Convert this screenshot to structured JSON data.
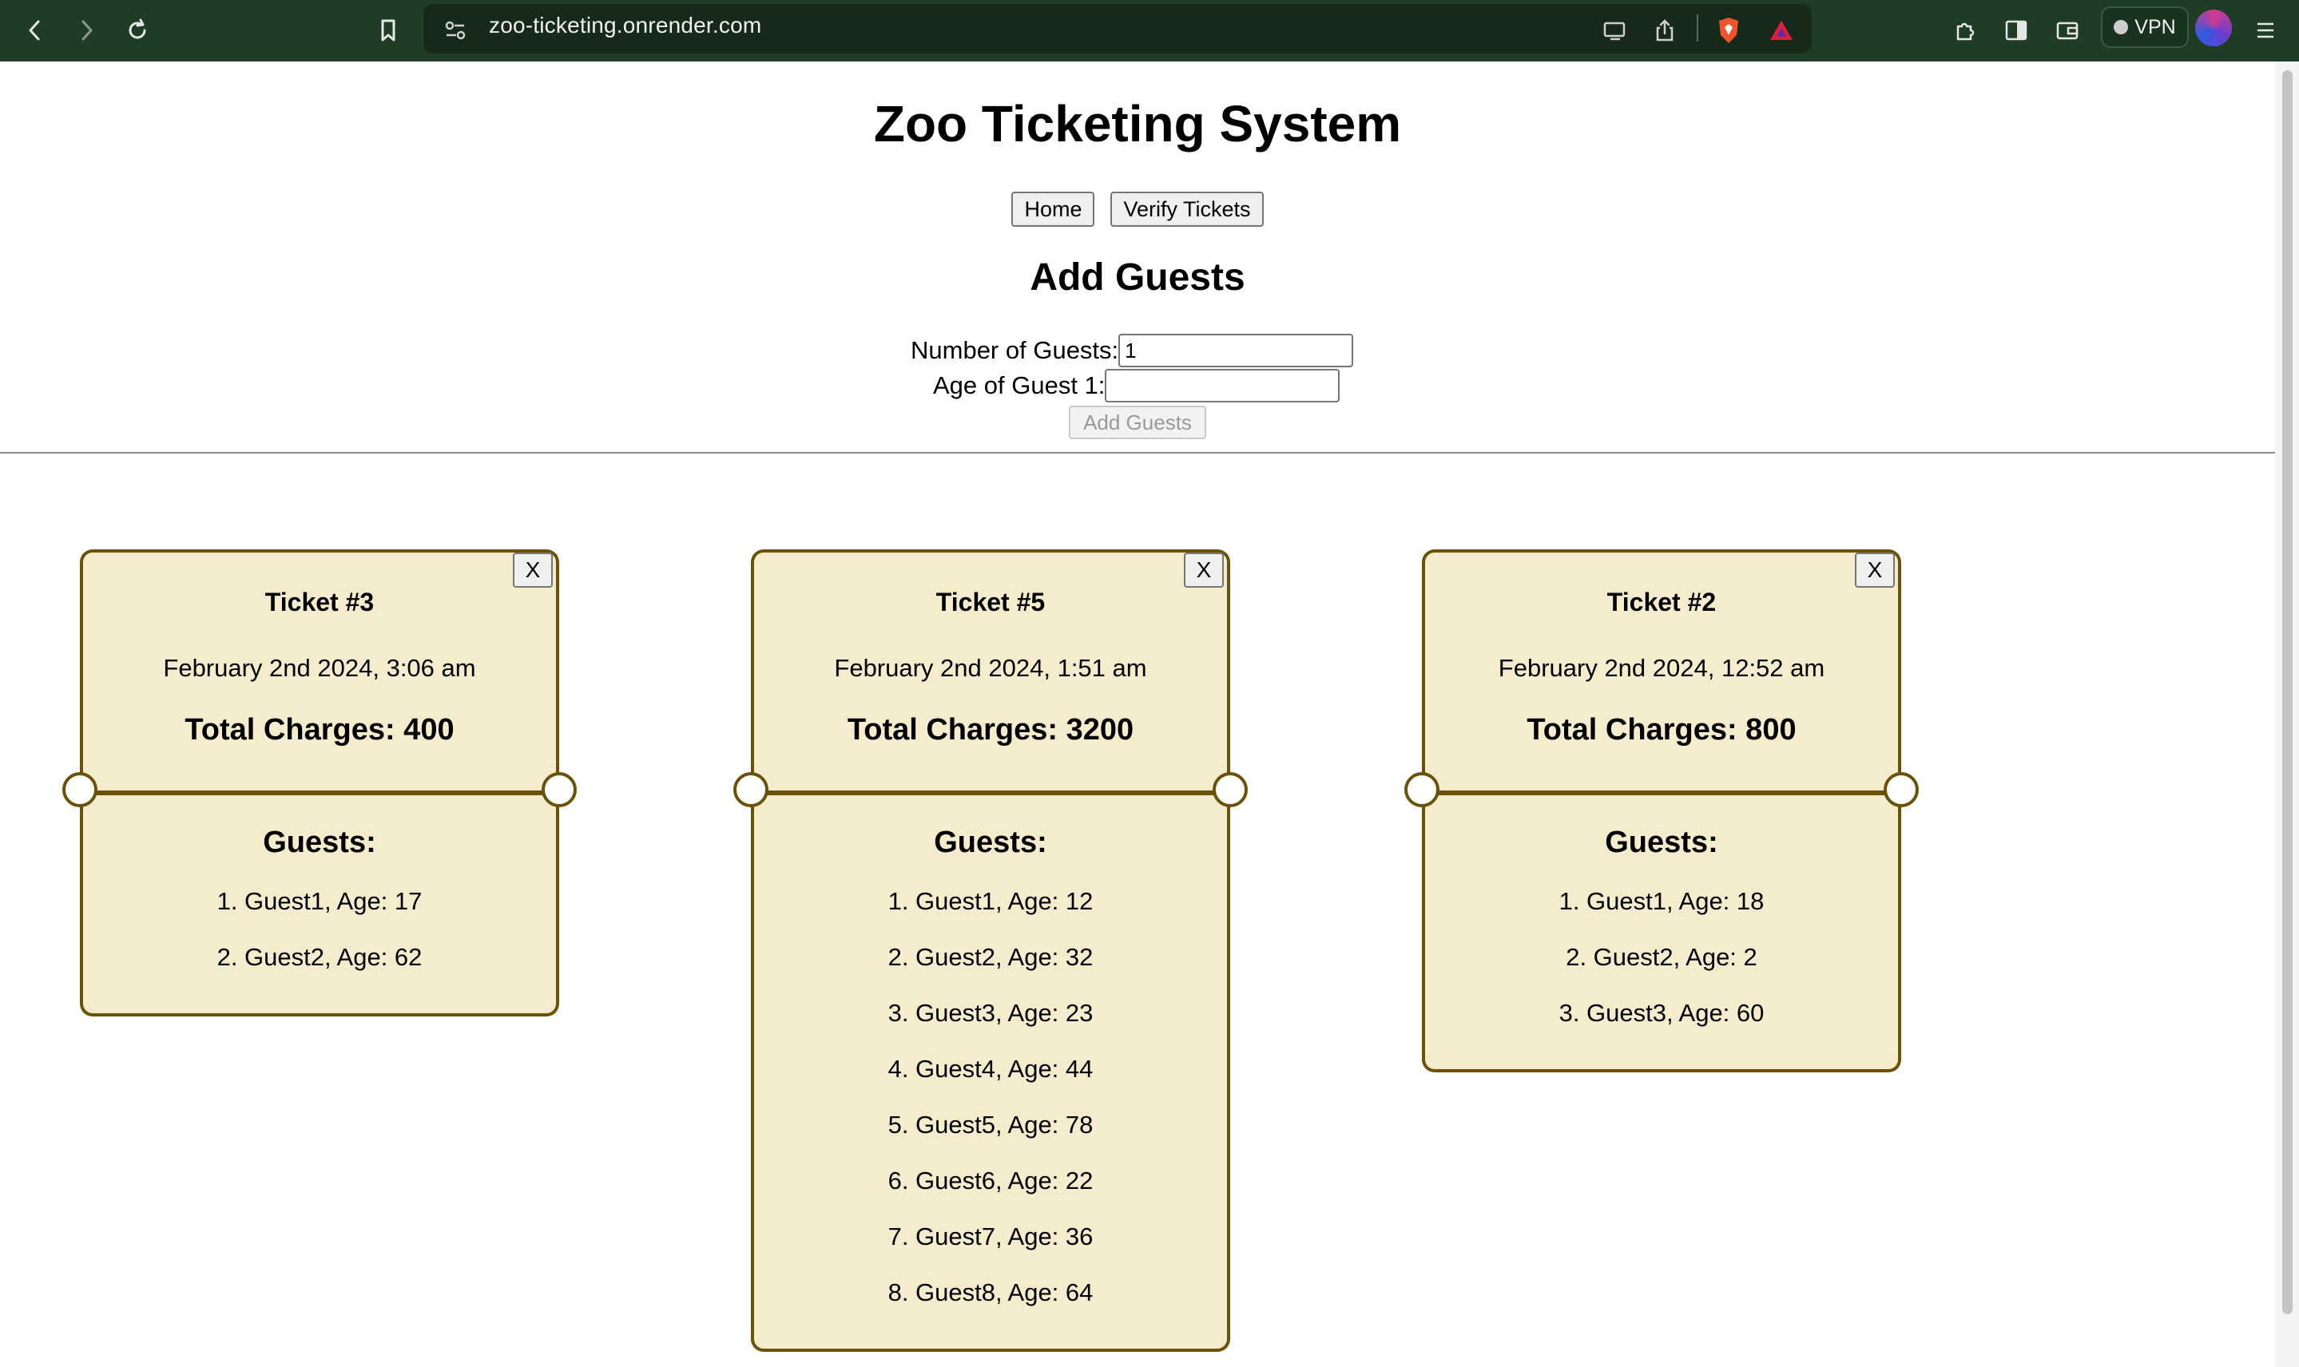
{
  "browser": {
    "url": "zoo-ticketing.onrender.com",
    "vpn_label": "VPN",
    "icons": [
      "back-icon",
      "forward-icon",
      "reload-icon",
      "bookmark-icon",
      "site-settings-icon",
      "cast-icon",
      "share-icon",
      "brave-shields-icon",
      "brave-rewards-icon",
      "extensions-icon",
      "sidebar-icon",
      "wallet-icon",
      "vpn-icon",
      "profile-avatar",
      "menu-icon"
    ],
    "colors": {
      "toolbar": "#1f3d24",
      "url_bar": "#172a19"
    }
  },
  "page": {
    "title": "Zoo Ticketing System",
    "nav": {
      "home": "Home",
      "verify": "Verify Tickets"
    },
    "add_guests": {
      "title": "Add Guests",
      "num_guests_label": "Number of Guests:",
      "num_guests_value": "1",
      "age_label": "Age of Guest 1:",
      "age_value": "",
      "submit_label": "Add Guests"
    }
  },
  "tickets": [
    {
      "close": "X",
      "title": "Ticket #3",
      "date": "February 2nd 2024, 3:06 am",
      "total": "Total Charges: 400",
      "guests_title": "Guests:",
      "guests": [
        "1. Guest1, Age: 17",
        "2. Guest2, Age: 62"
      ]
    },
    {
      "close": "X",
      "title": "Ticket #5",
      "date": "February 2nd 2024, 1:51 am",
      "total": "Total Charges: 3200",
      "guests_title": "Guests:",
      "guests": [
        "1. Guest1, Age: 12",
        "2. Guest2, Age: 32",
        "3. Guest3, Age: 23",
        "4. Guest4, Age: 44",
        "5. Guest5, Age: 78",
        "6. Guest6, Age: 22",
        "7. Guest7, Age: 36",
        "8. Guest8, Age: 64"
      ]
    },
    {
      "close": "X",
      "title": "Ticket #2",
      "date": "February 2nd 2024, 12:52 am",
      "total": "Total Charges: 800",
      "guests_title": "Guests:",
      "guests": [
        "1. Guest1, Age: 18",
        "2. Guest2, Age: 2",
        "3. Guest3, Age: 60"
      ]
    }
  ],
  "colors": {
    "ticket_bg": "#f4eccd",
    "ticket_border": "#6b5208"
  }
}
